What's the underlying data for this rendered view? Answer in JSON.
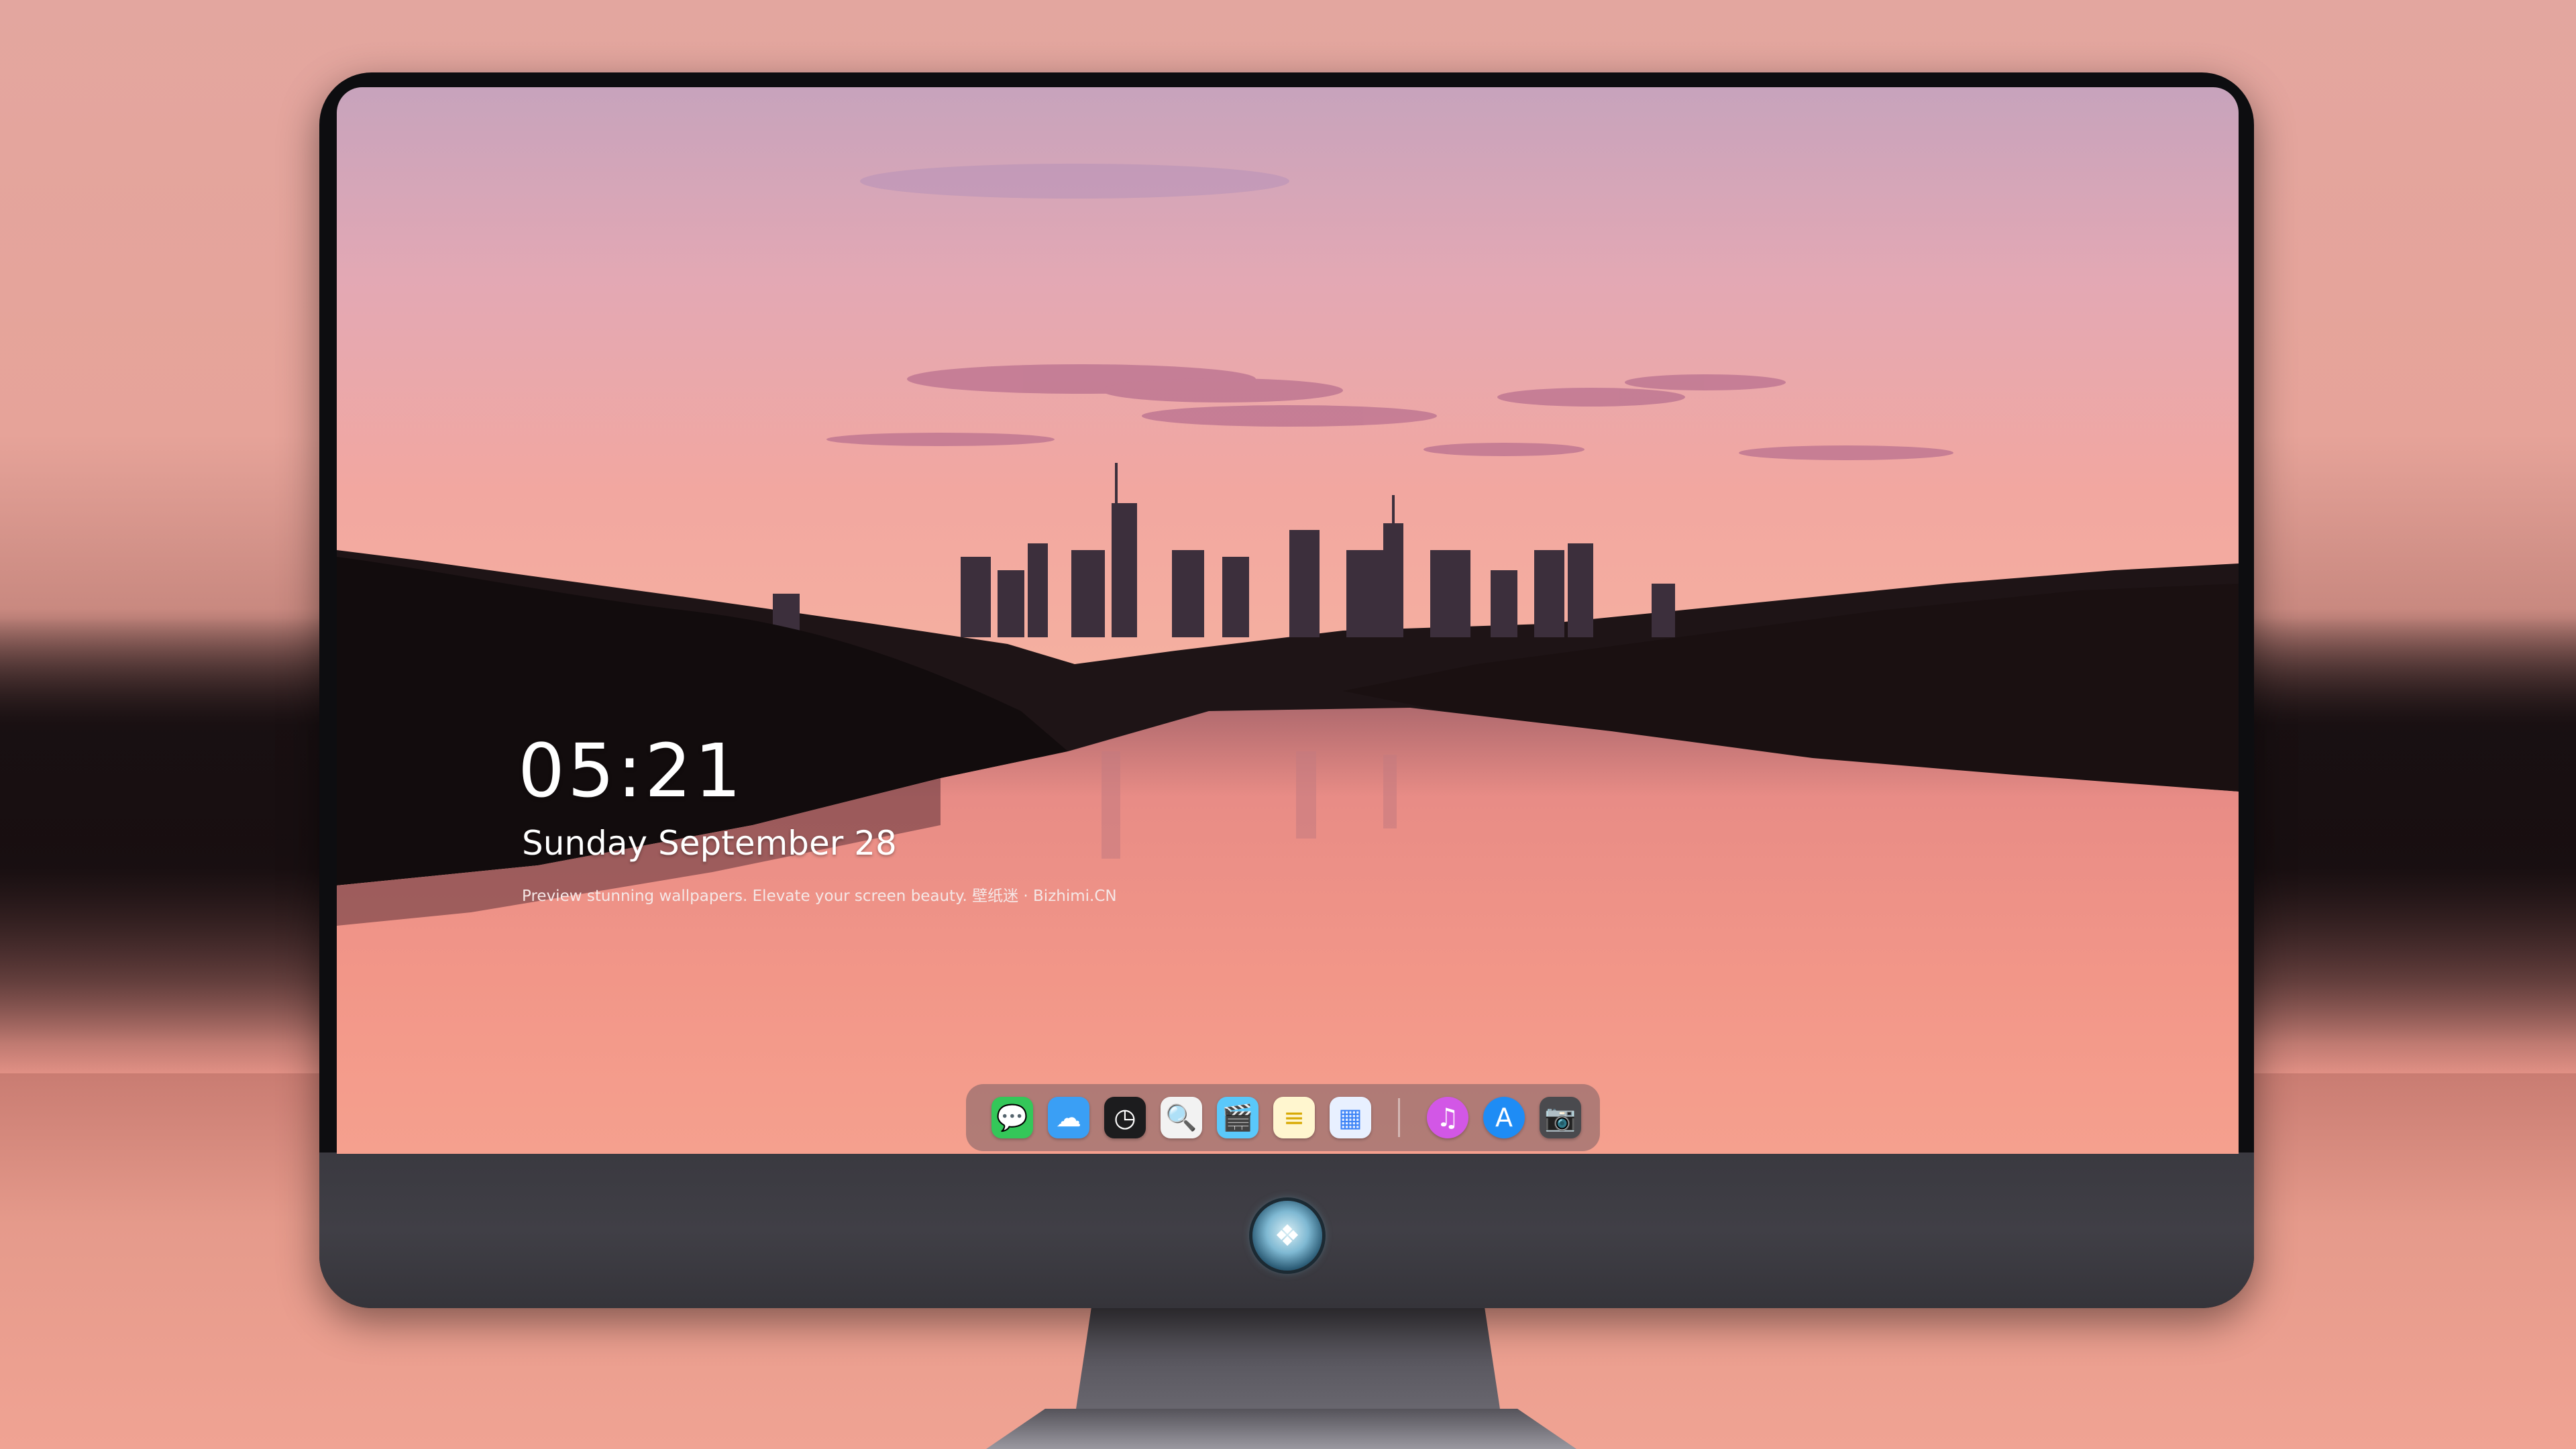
{
  "lock_screen": {
    "time": "05:21",
    "date": "Sunday September  28",
    "tagline": "Preview stunning wallpapers. Elevate your screen beauty. 壁纸迷 · Bizhimi.CN"
  },
  "dock": {
    "apps": [
      {
        "name": "messages-icon",
        "glyph": "💬",
        "color": "#34c759"
      },
      {
        "name": "weather-icon",
        "glyph": "☁",
        "color": "#3a9ff5"
      },
      {
        "name": "clock-icon",
        "glyph": "◷",
        "color": "#1c1c1e"
      },
      {
        "name": "preview-icon",
        "glyph": "🔍",
        "color": "#f2f2f2"
      },
      {
        "name": "clapper-icon",
        "glyph": "🎬",
        "color": "#5ac8fa"
      },
      {
        "name": "notes-icon",
        "glyph": "≡",
        "color": "#fff6cf"
      },
      {
        "name": "photo-booth-icon",
        "glyph": "▦",
        "color": "#e8f0ff"
      },
      {
        "name": "itunes-icon",
        "glyph": "♫",
        "color": "#d257e6"
      },
      {
        "name": "app-store-icon",
        "glyph": "A",
        "color": "#1e8cf5"
      },
      {
        "name": "camera-icon",
        "glyph": "📷",
        "color": "#4a4a4e"
      }
    ]
  },
  "monitor": {
    "logo_icon": "mascot-badge-icon"
  }
}
